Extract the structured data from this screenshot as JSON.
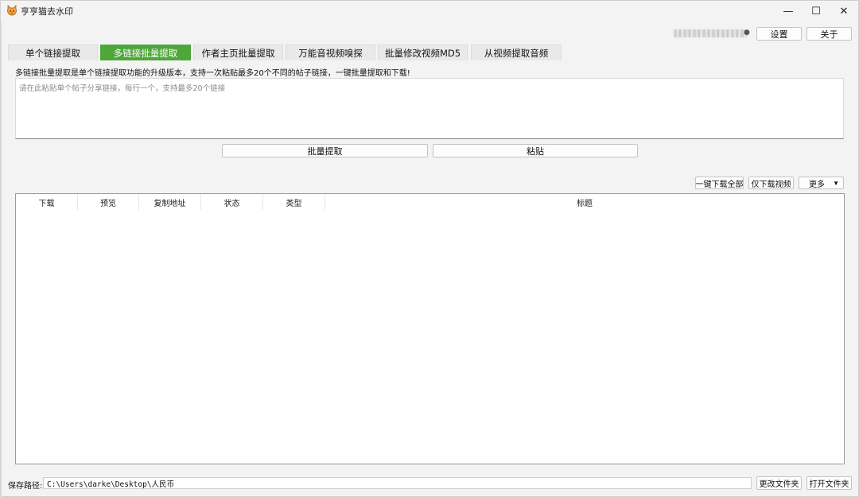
{
  "window": {
    "title": "亨亨猫去水印",
    "controls": {
      "minimize": "—",
      "maximize": "☐",
      "close": "✕"
    }
  },
  "header": {
    "settings_label": "设置",
    "about_label": "关于"
  },
  "tabs": [
    {
      "label": "单个链接提取",
      "active": false
    },
    {
      "label": "多链接批量提取",
      "active": true
    },
    {
      "label": "作者主页批量提取",
      "active": false
    },
    {
      "label": "万能音视频嗅探",
      "active": false
    },
    {
      "label": "批量修改视频MD5",
      "active": false
    },
    {
      "label": "从视频提取音频",
      "active": false
    }
  ],
  "main": {
    "description": "多链接批量提取是单个链接提取功能的升级版本，支持一次粘贴最多20个不同的帖子链接，一键批量提取和下载!",
    "links_input": {
      "value": "",
      "placeholder": "请在此粘贴单个帖子分享链接，每行一个，支持最多20个链接"
    },
    "batch_extract_label": "批量提取",
    "paste_label": "粘贴",
    "download_all_label": "一键下载全部",
    "download_video_label": "仅下载视频",
    "more_label": "更多",
    "table": {
      "columns": [
        "下载",
        "预览",
        "复制地址",
        "状态",
        "类型",
        "标题"
      ],
      "rows": []
    }
  },
  "footer": {
    "save_path_label": "保存路径:",
    "save_path_value": "C:\\Users\\darke\\Desktop\\人民币",
    "change_folder_label": "更改文件夹",
    "open_folder_label": "打开文件夹"
  },
  "colors": {
    "active_tab": "#4fa73a",
    "window_bg": "#f3f3f3"
  }
}
